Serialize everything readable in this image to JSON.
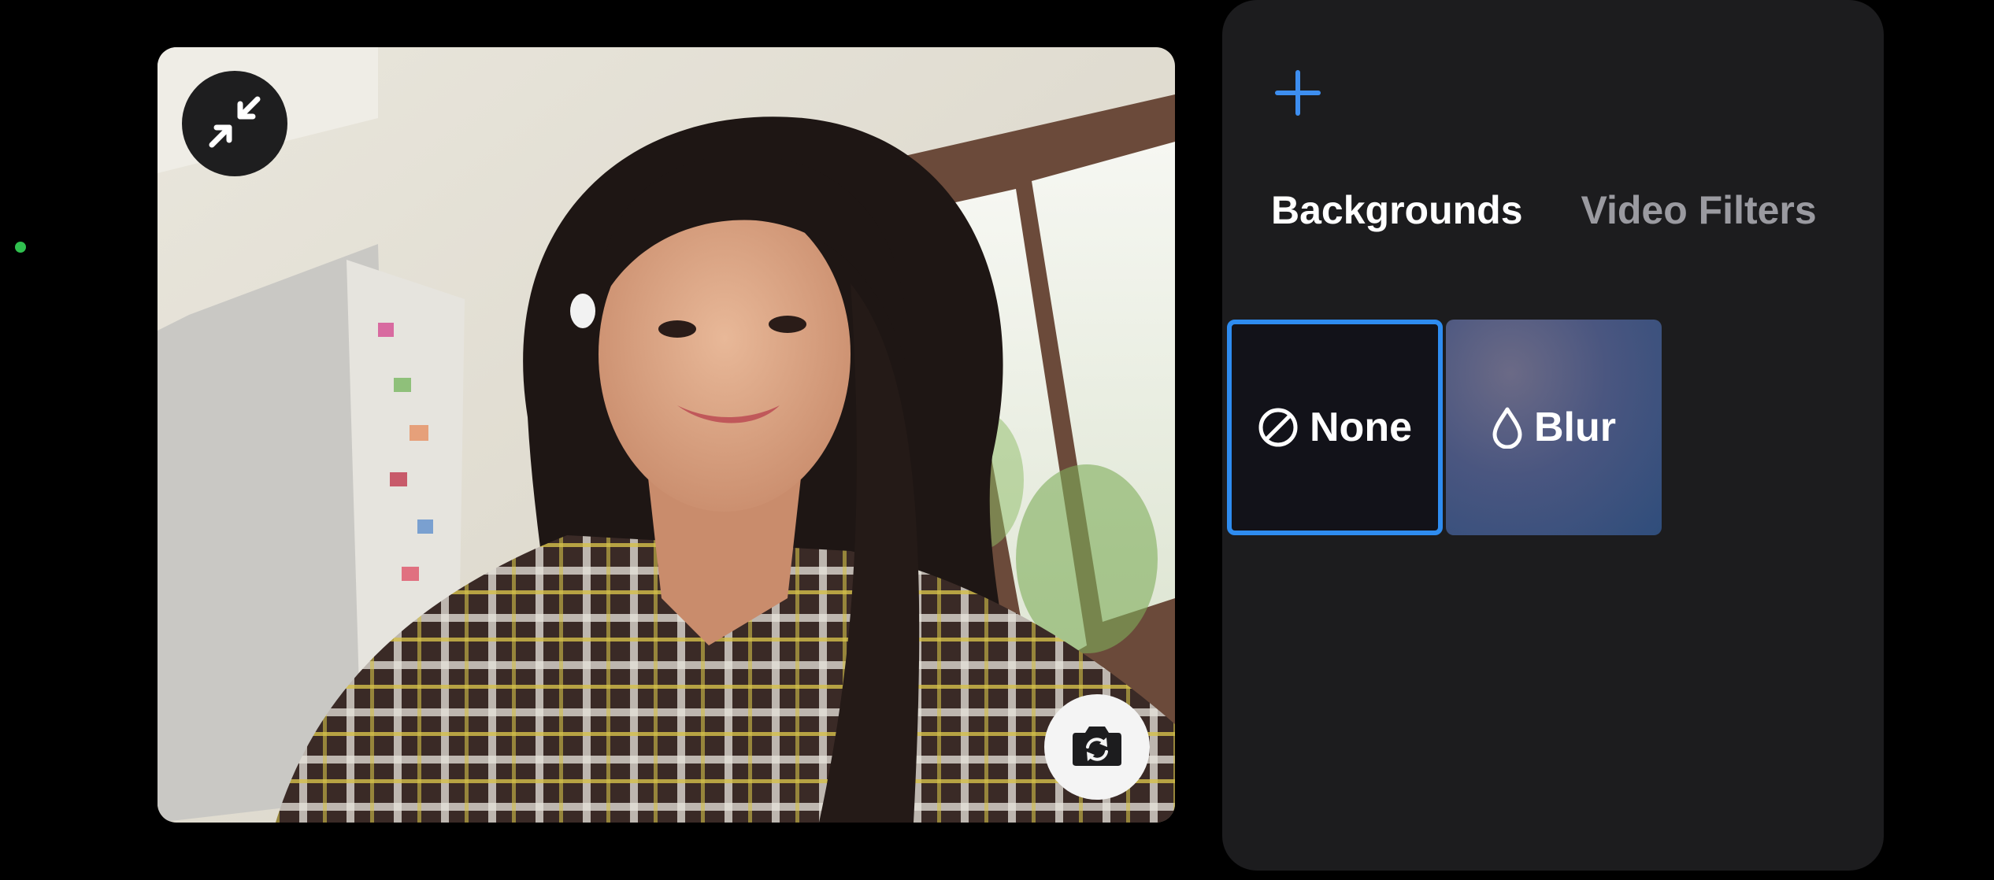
{
  "status": {
    "indicator_color": "#30c04f"
  },
  "preview": {
    "minimize_icon": "minimize-arrows-icon",
    "flip_icon": "camera-flip-icon"
  },
  "panel": {
    "add_icon": "plus-icon",
    "accent_color": "#2e8cf0",
    "tabs": [
      {
        "label": "Backgrounds",
        "active": true
      },
      {
        "label": "Video Filters",
        "active": false
      }
    ],
    "options": [
      {
        "label": "None",
        "icon": "none-icon",
        "selected": true
      },
      {
        "label": "Blur",
        "icon": "blur-drop-icon",
        "selected": false
      }
    ]
  }
}
